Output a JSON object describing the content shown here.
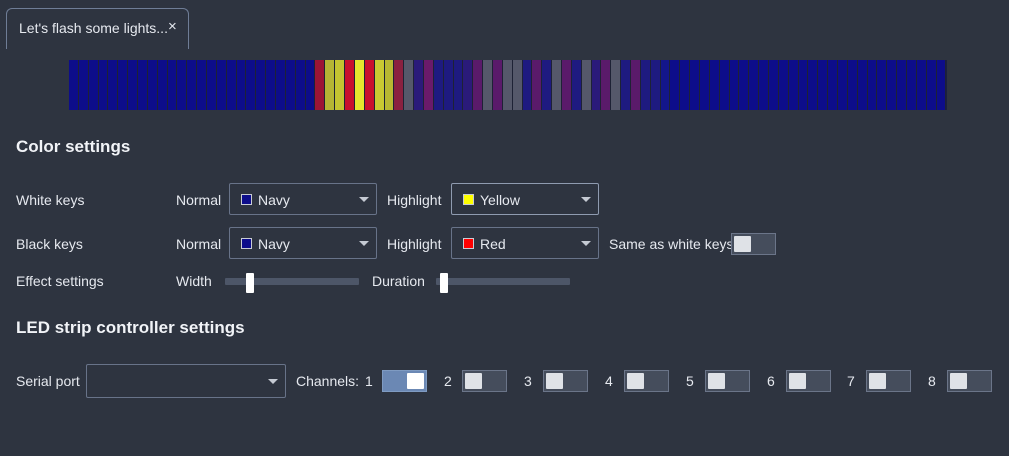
{
  "tab": {
    "title": "Let's flash some lights...",
    "close": "×"
  },
  "led_strip": {
    "leds": [
      "#0d0d8a",
      "#0d0d8a",
      "#0d0d8a",
      "#0d0d8a",
      "#0d0d8a",
      "#0d0d8a",
      "#0d0d8a",
      "#0d0d8a",
      "#0d0d8a",
      "#0d0d8a",
      "#0d0d8a",
      "#0d0d8a",
      "#0d0d8a",
      "#0d0d8a",
      "#0d0d8a",
      "#0d0d8a",
      "#0d0d8a",
      "#0d0d8a",
      "#0d0d8a",
      "#0d0d8a",
      "#0d0d8a",
      "#0d0d8a",
      "#0d0d8a",
      "#0d0d8a",
      "#0d0d8a",
      "#9c1535",
      "#b5b534",
      "#c4c431",
      "#c8102e",
      "#e6e62e",
      "#c8102e",
      "#c9c932",
      "#b8b832",
      "#8a2040",
      "#55586a",
      "#2a1a7a",
      "#6a1a6a",
      "#1e1a80",
      "#1e1a80",
      "#1e1a80",
      "#2a1a7a",
      "#5a1a6a",
      "#55586a",
      "#5a1a6a",
      "#55586a",
      "#55586a",
      "#1e1a80",
      "#5a1a6a",
      "#1e1a80",
      "#55586a",
      "#5a1a6a",
      "#1e1a80",
      "#55586a",
      "#2a1a7a",
      "#5a1a6a",
      "#55586a",
      "#1e1a80",
      "#5a1a6a",
      "#1e1a80",
      "#1e1a80",
      "#13168a",
      "#0d0d8a",
      "#0d0d8a",
      "#0d0d8a",
      "#0d0d8a",
      "#0d0d8a",
      "#0d0d8a",
      "#0d0d8a",
      "#0d0d8a",
      "#0d0d8a",
      "#0d0d8a",
      "#0d0d8a",
      "#0d0d8a",
      "#0d0d8a",
      "#0d0d8a",
      "#0d0d8a",
      "#0d0d8a",
      "#0d0d8a",
      "#0d0d8a",
      "#0d0d8a",
      "#0d0d8a",
      "#0d0d8a",
      "#0d0d8a",
      "#0d0d8a",
      "#0d0d8a",
      "#0d0d8a",
      "#0d0d8a",
      "#0d0d8a",
      "#0d0d8a"
    ]
  },
  "color_settings": {
    "heading": "Color settings",
    "white_keys": {
      "label": "White keys",
      "normal_label": "Normal",
      "normal_value": "Navy",
      "normal_color": "#0d0d8a",
      "highlight_label": "Highlight",
      "highlight_value": "Yellow",
      "highlight_color": "#ffff00"
    },
    "black_keys": {
      "label": "Black keys",
      "normal_label": "Normal",
      "normal_value": "Navy",
      "normal_color": "#0d0d8a",
      "highlight_label": "Highlight",
      "highlight_value": "Red",
      "highlight_color": "#ff0000",
      "same_as_white_label": "Same as white keys",
      "same_as_white_on": false
    },
    "effect": {
      "label": "Effect settings",
      "width_label": "Width",
      "width_value": 0.19,
      "duration_label": "Duration",
      "duration_value": 0.06
    }
  },
  "led_settings": {
    "heading": "LED strip controller settings",
    "serial_port_label": "Serial port",
    "serial_port_value": "",
    "channels_label": "Channels:",
    "channels": [
      {
        "label": "1",
        "on": true
      },
      {
        "label": "2",
        "on": false
      },
      {
        "label": "3",
        "on": false
      },
      {
        "label": "4",
        "on": false
      },
      {
        "label": "5",
        "on": false
      },
      {
        "label": "6",
        "on": false
      },
      {
        "label": "7",
        "on": false
      },
      {
        "label": "8",
        "on": false
      }
    ]
  }
}
